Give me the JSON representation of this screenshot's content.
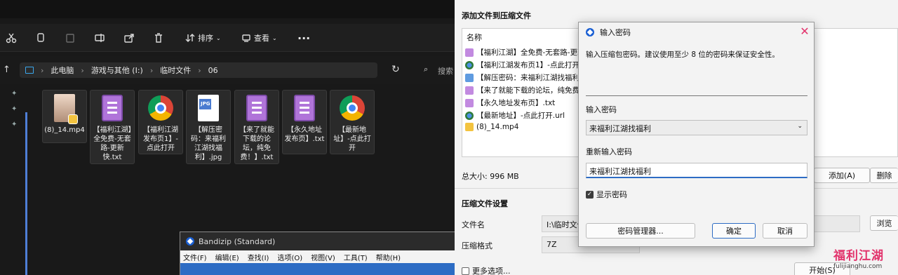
{
  "explorer": {
    "toolbar": {
      "sort_label": "排序",
      "view_label": "查看",
      "more_label": "···"
    },
    "breadcrumb": [
      "此电脑",
      "游戏与其他 (I:)",
      "临时文件",
      "06"
    ],
    "search_label": "搜索",
    "files": [
      {
        "name": "(8)_14.mp4",
        "kind": "video"
      },
      {
        "name": "【福利江湖】全免费-无套路-更新快.txt",
        "kind": "txt"
      },
      {
        "name": "【福利江湖发布页1】-点此打开",
        "kind": "url"
      },
      {
        "name": "【解压密码：来福利江湖找福利】.jpg",
        "kind": "jpg"
      },
      {
        "name": "【来了就能下载的论坛，纯免费！】.txt",
        "kind": "txt"
      },
      {
        "name": "【永久地址发布页】.txt",
        "kind": "txt"
      },
      {
        "name": "【最新地址】-点此打开",
        "kind": "url"
      }
    ],
    "jpg_badge": "JPG"
  },
  "bandizip": {
    "title": "Bandizip (Standard)",
    "menu": [
      "文件(F)",
      "编辑(E)",
      "查找(I)",
      "选项(O)",
      "视图(V)",
      "工具(T)",
      "帮助(H)"
    ]
  },
  "archive_dialog": {
    "title": "添加文件到压缩文件",
    "list_header": "名称",
    "list_items": [
      {
        "name": "【福利江湖】全免费-无套路-更新快.txt",
        "kind": "txt"
      },
      {
        "name": "【福利江湖发布页1】-点此打开.url",
        "kind": "url"
      },
      {
        "name": "【解压密码：来福利江湖找福利】.jpg",
        "kind": "jpg"
      },
      {
        "name": "【来了就能下载的论坛，纯免费！】.txt",
        "kind": "txt"
      },
      {
        "name": "【永久地址发布页】.txt",
        "kind": "txt"
      },
      {
        "name": "【最新地址】-点此打开.url",
        "kind": "url"
      },
      {
        "name": "(8)_14.mp4",
        "kind": "mp4"
      }
    ],
    "total_size": "总大小: 996 MB",
    "add_button": "添加(A)",
    "delete_button": "删除",
    "section_title": "压缩文件设置",
    "filename_label": "文件名",
    "filename_value": "I:\\临时文件",
    "browse_button": "浏览",
    "format_label": "压缩格式",
    "format_value": "7Z",
    "more_options": "更多选项...",
    "start_button": "开始(S)"
  },
  "password_dialog": {
    "title": "输入密码",
    "description": "输入压缩包密码。建议使用至少 8 位的密码来保证安全性。",
    "password_label": "输入密码",
    "password_value": "来福利江湖找福利",
    "confirm_label": "重新输入密码",
    "confirm_value": "来福利江湖找福利",
    "show_password": "显示密码",
    "manager_button": "密码管理器...",
    "ok_button": "确定",
    "cancel_button": "取消"
  },
  "watermark": {
    "brand": "福利江湖",
    "site": "fulijianghu.com"
  },
  "colors": {
    "accent_blue": "#2d6cc4",
    "watermark_pink": "#e2336c",
    "explorer_bg": "#191919"
  }
}
